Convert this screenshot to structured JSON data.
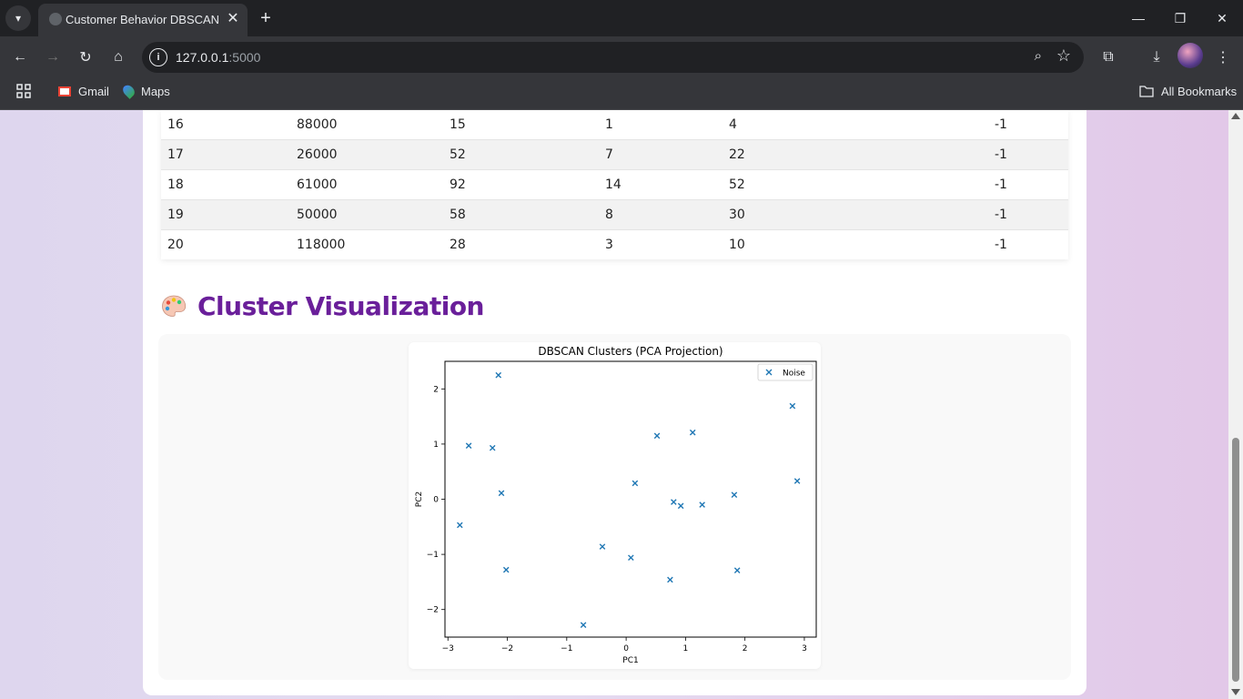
{
  "browser": {
    "tab_title": "Customer Behavior DBSCAN",
    "url_host": "127.0.0.1",
    "url_port": ":5000",
    "bookmarks": [
      "Gmail",
      "Maps"
    ],
    "all_bookmarks": "All Bookmarks"
  },
  "table": {
    "rows": [
      [
        "16",
        "88000",
        "15",
        "1",
        "4",
        "-1"
      ],
      [
        "17",
        "26000",
        "52",
        "7",
        "22",
        "-1"
      ],
      [
        "18",
        "61000",
        "92",
        "14",
        "52",
        "-1"
      ],
      [
        "19",
        "50000",
        "58",
        "8",
        "30",
        "-1"
      ],
      [
        "20",
        "118000",
        "28",
        "3",
        "10",
        "-1"
      ]
    ]
  },
  "section": {
    "heading": "Cluster Visualization"
  },
  "chart_data": {
    "type": "scatter",
    "title": "DBSCAN Clusters (PCA Projection)",
    "xlabel": "PC1",
    "ylabel": "PC2",
    "xlim": [
      -3.05,
      3.2
    ],
    "ylim": [
      -2.5,
      2.5
    ],
    "xticks": [
      "−3",
      "−2",
      "−1",
      "0",
      "1",
      "2",
      "3"
    ],
    "xtick_values": [
      -3,
      -2,
      -1,
      0,
      1,
      2,
      3
    ],
    "yticks": [
      "−2",
      "−1",
      "0",
      "1",
      "2"
    ],
    "ytick_values": [
      -2,
      -1,
      0,
      1,
      2
    ],
    "legend_position": "top-right",
    "marker": "x",
    "color": "#1f77b4",
    "series": [
      {
        "name": "Noise",
        "points": [
          [
            -2.15,
            2.25
          ],
          [
            -2.65,
            0.97
          ],
          [
            -2.25,
            0.93
          ],
          [
            -2.1,
            0.11
          ],
          [
            -2.8,
            -0.47
          ],
          [
            -2.02,
            -1.28
          ],
          [
            -0.72,
            -2.28
          ],
          [
            -0.4,
            -0.86
          ],
          [
            0.08,
            -1.06
          ],
          [
            0.15,
            0.29
          ],
          [
            0.52,
            1.15
          ],
          [
            1.12,
            1.21
          ],
          [
            0.8,
            -0.05
          ],
          [
            0.92,
            -0.12
          ],
          [
            0.74,
            -1.46
          ],
          [
            1.28,
            -0.1
          ],
          [
            1.82,
            0.08
          ],
          [
            1.87,
            -1.29
          ],
          [
            2.8,
            1.69
          ],
          [
            2.88,
            0.33
          ]
        ]
      }
    ]
  }
}
